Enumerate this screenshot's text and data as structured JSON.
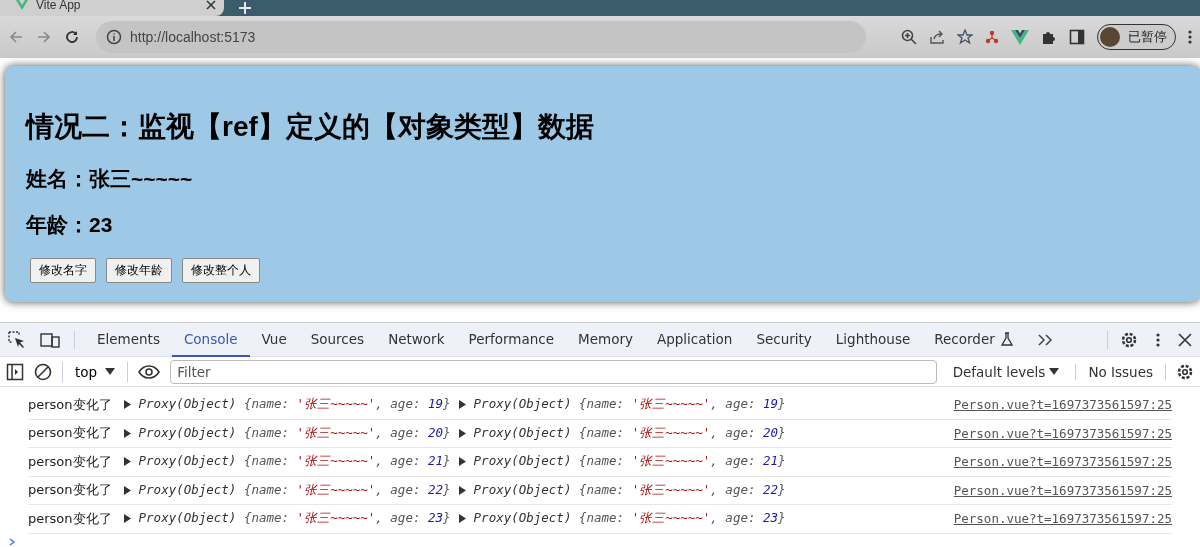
{
  "browser": {
    "tab": {
      "title": "Vite App"
    },
    "url": "http://localhost:5173",
    "profile": "已暂停"
  },
  "app": {
    "title": "情况二：监视【ref】定义的【对象类型】数据",
    "name_line": "姓名：张三~~~~~",
    "age_line": "年龄：23",
    "buttons": [
      "修改名字",
      "修改年龄",
      "修改整个人"
    ]
  },
  "devtools": {
    "tabs": [
      {
        "label": "Elements",
        "selected": false
      },
      {
        "label": "Console",
        "selected": true
      },
      {
        "label": "Vue",
        "selected": false
      },
      {
        "label": "Sources",
        "selected": false
      },
      {
        "label": "Network",
        "selected": false
      },
      {
        "label": "Performance",
        "selected": false
      },
      {
        "label": "Memory",
        "selected": false
      },
      {
        "label": "Application",
        "selected": false
      },
      {
        "label": "Security",
        "selected": false
      },
      {
        "label": "Lighthouse",
        "selected": false
      },
      {
        "label": "Recorder",
        "selected": false
      }
    ],
    "context": "top",
    "filter_placeholder": "Filter",
    "levels": "Default levels",
    "issues": "No Issues",
    "logs": [
      {
        "message": "person变化了",
        "objects": [
          {
            "type": "Proxy(Object)",
            "pieces": [
              {
                "kind": "key",
                "text": "{name: "
              },
              {
                "kind": "string",
                "text": "'张三~~~~~'"
              },
              {
                "kind": "key",
                "text": ", age: "
              },
              {
                "kind": "number",
                "text": "19"
              },
              {
                "kind": "key",
                "text": "}"
              }
            ]
          },
          {
            "type": "Proxy(Object)",
            "pieces": [
              {
                "kind": "key",
                "text": "{name: "
              },
              {
                "kind": "string",
                "text": "'张三~~~~~'"
              },
              {
                "kind": "key",
                "text": ", age: "
              },
              {
                "kind": "number",
                "text": "19"
              },
              {
                "kind": "key",
                "text": "}"
              }
            ]
          }
        ],
        "source": "Person.vue?t=1697373561597:25"
      },
      {
        "message": "person变化了",
        "objects": [
          {
            "type": "Proxy(Object)",
            "pieces": [
              {
                "kind": "key",
                "text": "{name: "
              },
              {
                "kind": "string",
                "text": "'张三~~~~~'"
              },
              {
                "kind": "key",
                "text": ", age: "
              },
              {
                "kind": "number",
                "text": "20"
              },
              {
                "kind": "key",
                "text": "}"
              }
            ]
          },
          {
            "type": "Proxy(Object)",
            "pieces": [
              {
                "kind": "key",
                "text": "{name: "
              },
              {
                "kind": "string",
                "text": "'张三~~~~~'"
              },
              {
                "kind": "key",
                "text": ", age: "
              },
              {
                "kind": "number",
                "text": "20"
              },
              {
                "kind": "key",
                "text": "}"
              }
            ]
          }
        ],
        "source": "Person.vue?t=1697373561597:25"
      },
      {
        "message": "person变化了",
        "objects": [
          {
            "type": "Proxy(Object)",
            "pieces": [
              {
                "kind": "key",
                "text": "{name: "
              },
              {
                "kind": "string",
                "text": "'张三~~~~~'"
              },
              {
                "kind": "key",
                "text": ", age: "
              },
              {
                "kind": "number",
                "text": "21"
              },
              {
                "kind": "key",
                "text": "}"
              }
            ]
          },
          {
            "type": "Proxy(Object)",
            "pieces": [
              {
                "kind": "key",
                "text": "{name: "
              },
              {
                "kind": "string",
                "text": "'张三~~~~~'"
              },
              {
                "kind": "key",
                "text": ", age: "
              },
              {
                "kind": "number",
                "text": "21"
              },
              {
                "kind": "key",
                "text": "}"
              }
            ]
          }
        ],
        "source": "Person.vue?t=1697373561597:25"
      },
      {
        "message": "person变化了",
        "objects": [
          {
            "type": "Proxy(Object)",
            "pieces": [
              {
                "kind": "key",
                "text": "{name: "
              },
              {
                "kind": "string",
                "text": "'张三~~~~~'"
              },
              {
                "kind": "key",
                "text": ", age: "
              },
              {
                "kind": "number",
                "text": "22"
              },
              {
                "kind": "key",
                "text": "}"
              }
            ]
          },
          {
            "type": "Proxy(Object)",
            "pieces": [
              {
                "kind": "key",
                "text": "{name: "
              },
              {
                "kind": "string",
                "text": "'张三~~~~~'"
              },
              {
                "kind": "key",
                "text": ", age: "
              },
              {
                "kind": "number",
                "text": "22"
              },
              {
                "kind": "key",
                "text": "}"
              }
            ]
          }
        ],
        "source": "Person.vue?t=1697373561597:25"
      },
      {
        "message": "person变化了",
        "objects": [
          {
            "type": "Proxy(Object)",
            "pieces": [
              {
                "kind": "key",
                "text": "{name: "
              },
              {
                "kind": "string",
                "text": "'张三~~~~~'"
              },
              {
                "kind": "key",
                "text": ", age: "
              },
              {
                "kind": "number",
                "text": "23"
              },
              {
                "kind": "key",
                "text": "}"
              }
            ]
          },
          {
            "type": "Proxy(Object)",
            "pieces": [
              {
                "kind": "key",
                "text": "{name: "
              },
              {
                "kind": "string",
                "text": "'张三~~~~~'"
              },
              {
                "kind": "key",
                "text": ", age: "
              },
              {
                "kind": "number",
                "text": "23"
              },
              {
                "kind": "key",
                "text": "}"
              }
            ]
          }
        ],
        "source": "Person.vue?t=1697373561597:25"
      }
    ]
  }
}
